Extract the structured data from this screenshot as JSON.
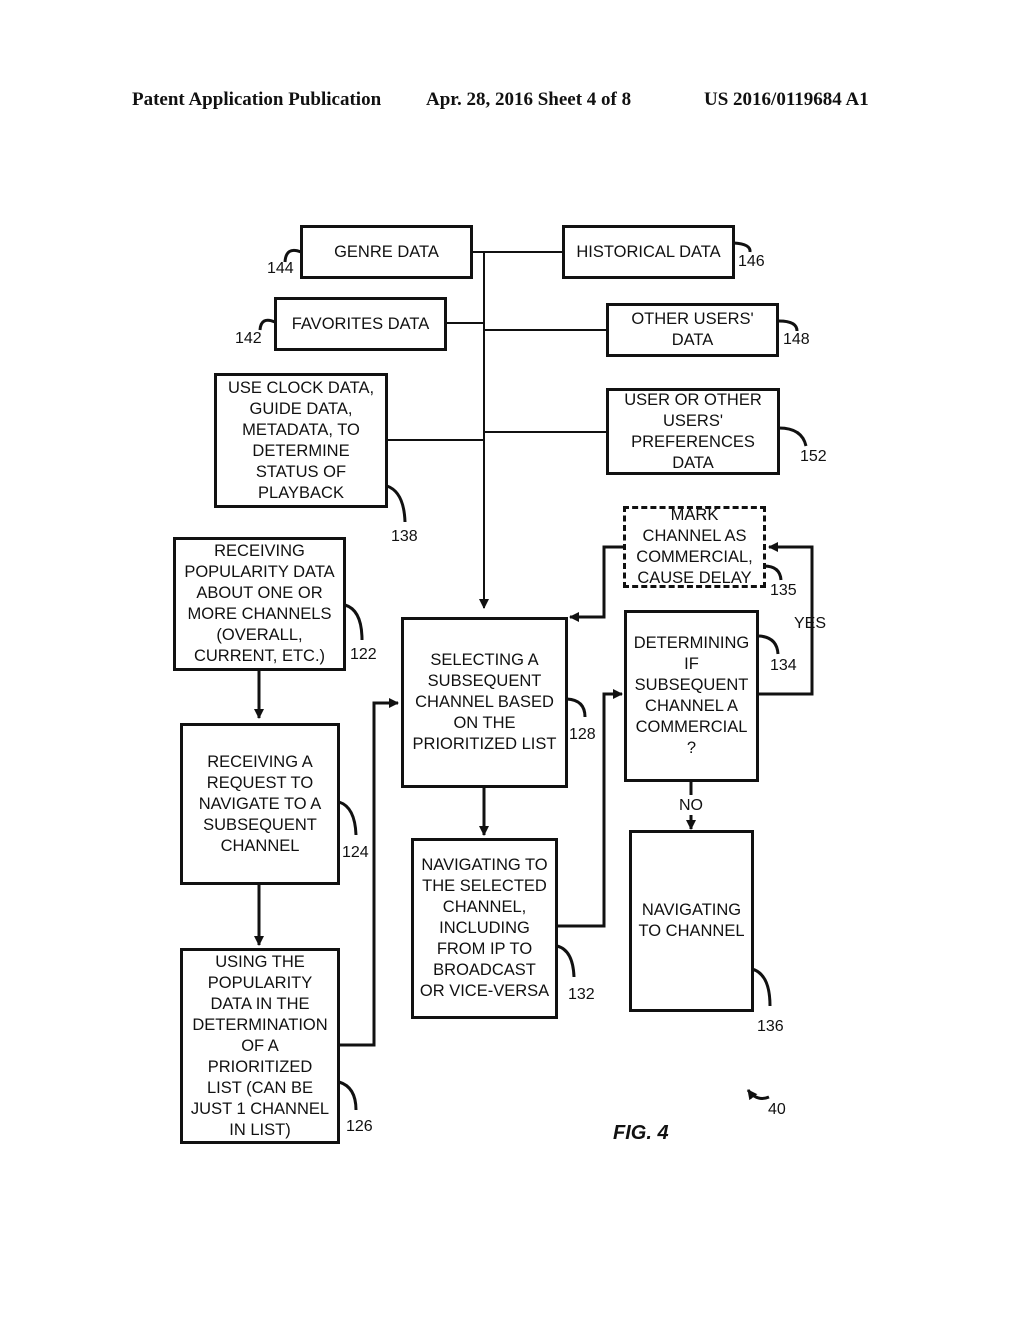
{
  "header": {
    "publication": "Patent Application Publication",
    "date_sheet": "Apr. 28, 2016  Sheet 4 of 8",
    "patent_number": "US 2016/0119684 A1"
  },
  "figure": {
    "label": "FIG. 4",
    "reference": "40"
  },
  "boxes": {
    "genre": {
      "text": "GENRE DATA",
      "ref": "144"
    },
    "historical": {
      "text": "HISTORICAL DATA",
      "ref": "146"
    },
    "favorites": {
      "text": "FAVORITES DATA",
      "ref": "142"
    },
    "other_users": {
      "text": "OTHER USERS'\nDATA",
      "ref": "148"
    },
    "clock": {
      "text": "USE CLOCK DATA,\nGUIDE DATA,\nMETADATA, TO\nDETERMINE\nSTATUS OF\nPLAYBACK",
      "ref": "138"
    },
    "preferences": {
      "text": "USER OR OTHER\nUSERS'\nPREFERENCES\nDATA",
      "ref": "152"
    },
    "mark_commercial": {
      "text": "MARK\nCHANNEL AS\nCOMMERCIAL,\nCAUSE DELAY",
      "ref": "135"
    },
    "receiving_popularity": {
      "text": "RECEIVING\nPOPULARITY DATA\nABOUT ONE OR\nMORE CHANNELS\n(OVERALL,\nCURRENT, ETC.)",
      "ref": "122"
    },
    "selecting": {
      "text": "SELECTING A\nSUBSEQUENT\nCHANNEL BASED\nON THE\nPRIORITIZED LIST",
      "ref": "128"
    },
    "determining": {
      "text": "DETERMINING\nIF\nSUBSEQUENT\nCHANNEL A\nCOMMERCIAL\n?",
      "ref": "134"
    },
    "receiving_request": {
      "text": "RECEIVING A\nREQUEST TO\nNAVIGATE TO A\nSUBSEQUENT\nCHANNEL",
      "ref": "124"
    },
    "navigating_selected": {
      "text": "NAVIGATING TO\nTHE SELECTED\nCHANNEL,\nINCLUDING\nFROM IP TO\nBROADCAST\nOR VICE-VERSA",
      "ref": "132"
    },
    "navigating_channel": {
      "text": "NAVIGATING\nTO CHANNEL",
      "ref": "136"
    },
    "using_popularity": {
      "text": "USING THE\nPOPULARITY\nDATA IN THE\nDETERMINATION\nOF A\nPRIORITIZED\nLIST (CAN BE\nJUST 1 CHANNEL\nIN LIST)",
      "ref": "126"
    }
  },
  "edge_labels": {
    "yes": "YES",
    "no": "NO"
  }
}
